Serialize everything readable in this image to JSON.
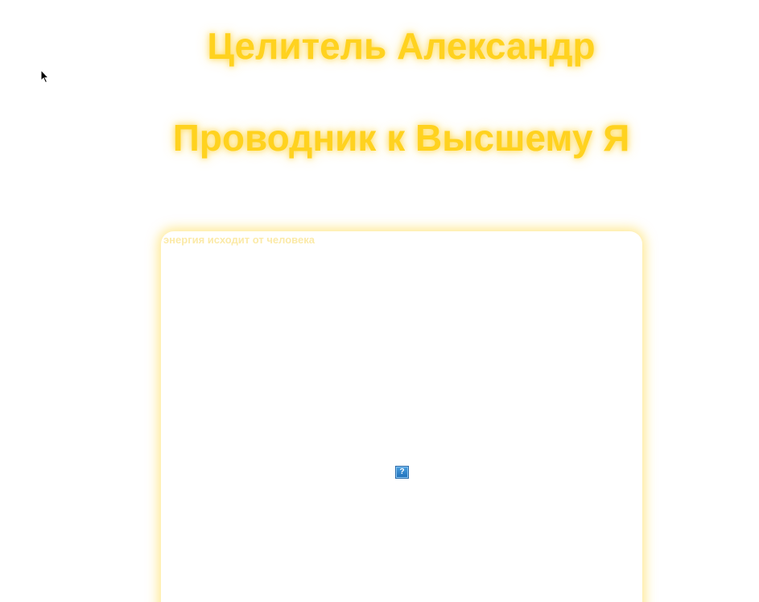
{
  "header": {
    "title_line_1": "Целитель Александр",
    "title_line_2": "Проводник к Высшему Я"
  },
  "video": {
    "caption": "энергия исходит от человека",
    "plugin_icon_glyph": "?"
  },
  "colors": {
    "title": "#ffd21f",
    "glow": "#ffd73c",
    "caption": "#fbeaa8",
    "plugin_icon": "#1f6fb8"
  },
  "icons": {
    "cursor": "mouse-pointer-icon",
    "plugin": "missing-plugin-icon"
  }
}
